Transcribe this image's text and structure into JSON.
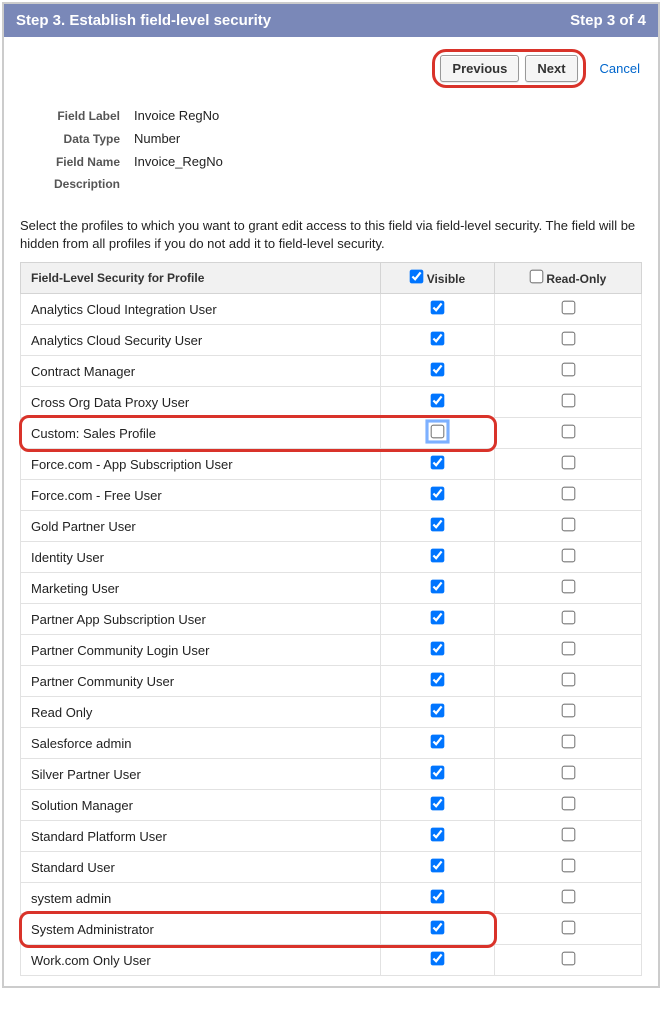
{
  "header": {
    "title": "Step 3. Establish field-level security",
    "step_indicator": "Step 3 of 4"
  },
  "nav": {
    "previous": "Previous",
    "next": "Next",
    "cancel": "Cancel"
  },
  "details": {
    "field_label_label": "Field Label",
    "field_label_value": "Invoice RegNo",
    "data_type_label": "Data Type",
    "data_type_value": "Number",
    "field_name_label": "Field Name",
    "field_name_value": "Invoice_RegNo",
    "description_label": "Description",
    "description_value": ""
  },
  "instructions": "Select the profiles to which you want to grant edit access to this field via field-level security. The field will be hidden from all profiles if you do not add it to field-level security.",
  "table": {
    "header_profile": "Field-Level Security for Profile",
    "header_visible": "Visible",
    "header_readonly": "Read-Only",
    "header_visible_checked": true,
    "header_readonly_checked": false,
    "rows": [
      {
        "name": "Analytics Cloud Integration User",
        "visible": true,
        "readonly": false,
        "highlight": false
      },
      {
        "name": "Analytics Cloud Security User",
        "visible": true,
        "readonly": false,
        "highlight": false
      },
      {
        "name": "Contract Manager",
        "visible": true,
        "readonly": false,
        "highlight": false
      },
      {
        "name": "Cross Org Data Proxy User",
        "visible": true,
        "readonly": false,
        "highlight": false
      },
      {
        "name": "Custom: Sales Profile",
        "visible": false,
        "readonly": false,
        "highlight": true,
        "visible_focus": true
      },
      {
        "name": "Force.com - App Subscription User",
        "visible": true,
        "readonly": false,
        "highlight": false
      },
      {
        "name": "Force.com - Free User",
        "visible": true,
        "readonly": false,
        "highlight": false
      },
      {
        "name": "Gold Partner User",
        "visible": true,
        "readonly": false,
        "highlight": false
      },
      {
        "name": "Identity User",
        "visible": true,
        "readonly": false,
        "highlight": false
      },
      {
        "name": "Marketing User",
        "visible": true,
        "readonly": false,
        "highlight": false
      },
      {
        "name": "Partner App Subscription User",
        "visible": true,
        "readonly": false,
        "highlight": false
      },
      {
        "name": "Partner Community Login User",
        "visible": true,
        "readonly": false,
        "highlight": false
      },
      {
        "name": "Partner Community User",
        "visible": true,
        "readonly": false,
        "highlight": false
      },
      {
        "name": "Read Only",
        "visible": true,
        "readonly": false,
        "highlight": false
      },
      {
        "name": "Salesforce admin",
        "visible": true,
        "readonly": false,
        "highlight": false
      },
      {
        "name": "Silver Partner User",
        "visible": true,
        "readonly": false,
        "highlight": false
      },
      {
        "name": "Solution Manager",
        "visible": true,
        "readonly": false,
        "highlight": false
      },
      {
        "name": "Standard Platform User",
        "visible": true,
        "readonly": false,
        "highlight": false
      },
      {
        "name": "Standard User",
        "visible": true,
        "readonly": false,
        "highlight": false
      },
      {
        "name": "system admin",
        "visible": true,
        "readonly": false,
        "highlight": false
      },
      {
        "name": "System Administrator",
        "visible": true,
        "readonly": false,
        "highlight": true
      },
      {
        "name": "Work.com Only User",
        "visible": true,
        "readonly": false,
        "highlight": false
      }
    ]
  }
}
